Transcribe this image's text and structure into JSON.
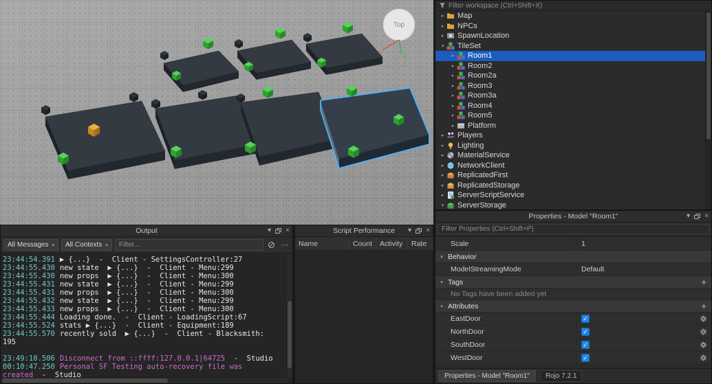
{
  "viewport": {
    "view_cube_label": "Top",
    "axis_x_label": "x",
    "axis_y_label": "y"
  },
  "explorer": {
    "filter_placeholder": "Filter workspace (Ctrl+Shift+X)",
    "items": [
      {
        "label": "Map",
        "icon": "folder",
        "depth": 0,
        "arrow": "collapsed",
        "selected": false
      },
      {
        "label": "NPCs",
        "icon": "folder",
        "depth": 0,
        "arrow": "collapsed",
        "selected": false
      },
      {
        "label": "SpawnLocation",
        "icon": "spawn",
        "depth": 0,
        "arrow": "collapsed",
        "selected": false
      },
      {
        "label": "TileSet",
        "icon": "model",
        "depth": 0,
        "arrow": "expanded",
        "selected": false
      },
      {
        "label": "Room1",
        "icon": "model",
        "depth": 1,
        "arrow": "collapsed",
        "selected": true
      },
      {
        "label": "Room2",
        "icon": "model",
        "depth": 1,
        "arrow": "collapsed",
        "selected": false
      },
      {
        "label": "Room2a",
        "icon": "model",
        "depth": 1,
        "arrow": "collapsed",
        "selected": false
      },
      {
        "label": "Room3",
        "icon": "model",
        "depth": 1,
        "arrow": "collapsed",
        "selected": false
      },
      {
        "label": "Room3a",
        "icon": "model",
        "depth": 1,
        "arrow": "collapsed",
        "selected": false
      },
      {
        "label": "Room4",
        "icon": "model",
        "depth": 1,
        "arrow": "collapsed",
        "selected": false
      },
      {
        "label": "Room5",
        "icon": "model",
        "depth": 1,
        "arrow": "collapsed",
        "selected": false
      },
      {
        "label": "Platform",
        "icon": "part",
        "depth": 1,
        "arrow": "collapsed",
        "selected": false
      },
      {
        "label": "Players",
        "icon": "players",
        "depth": 0,
        "arrow": "collapsed",
        "selected": false
      },
      {
        "label": "Lighting",
        "icon": "lighting",
        "depth": 0,
        "arrow": "collapsed",
        "selected": false
      },
      {
        "label": "MaterialService",
        "icon": "material",
        "depth": 0,
        "arrow": "collapsed",
        "selected": false
      },
      {
        "label": "NetworkClient",
        "icon": "network",
        "depth": 0,
        "arrow": "collapsed",
        "selected": false
      },
      {
        "label": "ReplicatedFirst",
        "icon": "repfirst",
        "depth": 0,
        "arrow": "collapsed",
        "selected": false
      },
      {
        "label": "ReplicatedStorage",
        "icon": "repstorage",
        "depth": 0,
        "arrow": "collapsed",
        "selected": false
      },
      {
        "label": "ServerScriptService",
        "icon": "serverscript",
        "depth": 0,
        "arrow": "collapsed",
        "selected": false
      },
      {
        "label": "ServerStorage",
        "icon": "serverstorage",
        "depth": 0,
        "arrow": "expanded",
        "selected": false
      }
    ]
  },
  "output": {
    "title": "Output",
    "toolbar": {
      "messages_filter": "All Messages",
      "contexts_filter": "All Contexts",
      "filter_placeholder": "Filter..."
    },
    "lines": [
      {
        "time": "23:44:54.391",
        "parts": [
          {
            "text": "▶ {...}  -  Client - SettingsController:27",
            "color": "default"
          }
        ]
      },
      {
        "time": "23:44:55.430",
        "parts": [
          {
            "text": "new state  ▶ {...}  -  Client - Menu:299",
            "color": "default"
          }
        ]
      },
      {
        "time": "23:44:55.430",
        "parts": [
          {
            "text": "new props  ▶ {...}  -  Client - Menu:300",
            "color": "default"
          }
        ]
      },
      {
        "time": "23:44:55.431",
        "parts": [
          {
            "text": "new state  ▶ {...}  -  Client - Menu:299",
            "color": "default"
          }
        ]
      },
      {
        "time": "23:44:55.431",
        "parts": [
          {
            "text": "new props  ▶ {...}  -  Client - Menu:300",
            "color": "default"
          }
        ]
      },
      {
        "time": "23:44:55.432",
        "parts": [
          {
            "text": "new state  ▶ {...}  -  Client - Menu:299",
            "color": "default"
          }
        ]
      },
      {
        "time": "23:44:55.433",
        "parts": [
          {
            "text": "new props  ▶ {...}  -  Client - Menu:300",
            "color": "default"
          }
        ]
      },
      {
        "time": "23:44:55.444",
        "parts": [
          {
            "text": "Loading done.  -  Client - LoadingScript:67",
            "color": "default"
          }
        ]
      },
      {
        "time": "23:44:55.524",
        "parts": [
          {
            "text": "stats ▶ {...}  -  Client - Equipment:189",
            "color": "default"
          }
        ]
      },
      {
        "time": "23:44:55.570",
        "parts": [
          {
            "text": "recently sold  ▶ {...}  -  Client - Blacksmith:",
            "color": "default"
          }
        ]
      },
      {
        "time": "",
        "parts": [
          {
            "text": "195",
            "color": "default"
          }
        ]
      },
      {
        "time": "",
        "parts": []
      },
      {
        "time": "23:49:10.506",
        "parts": [
          {
            "text": "Disconnect from ::ffff:127.0.0.1|64725",
            "color": "magenta"
          },
          {
            "text": "  -  Studio",
            "color": "default"
          }
        ]
      },
      {
        "time": "00:10:47.250",
        "parts": [
          {
            "text": "Personal SF Testing auto-recovery file was",
            "color": "magenta"
          }
        ]
      },
      {
        "time": "",
        "parts": [
          {
            "text": "created",
            "color": "magenta"
          },
          {
            "text": "  -  Studio",
            "color": "default"
          }
        ]
      }
    ]
  },
  "script_performance": {
    "title": "Script Performance",
    "columns": [
      "Name",
      "Count",
      "Activity",
      "Rate"
    ]
  },
  "properties": {
    "title": "Properties - Model \"Room1\"",
    "filter_placeholder": "Filter Properties (Ctrl+Shift+P)",
    "rows": [
      {
        "type": "prop",
        "label": "Scale",
        "value": "1"
      },
      {
        "type": "section",
        "label": "Behavior",
        "add": false
      },
      {
        "type": "prop",
        "label": "ModelStreamingMode",
        "value": "Default"
      },
      {
        "type": "section",
        "label": "Tags",
        "add": true
      },
      {
        "type": "note",
        "text": "No Tags have been added yet"
      },
      {
        "type": "section",
        "label": "Attributes",
        "add": true
      },
      {
        "type": "attr",
        "label": "EastDoor",
        "checked": true
      },
      {
        "type": "attr",
        "label": "NorthDoor",
        "checked": true
      },
      {
        "type": "attr",
        "label": "SouthDoor",
        "checked": true
      },
      {
        "type": "attr",
        "label": "WestDoor",
        "checked": true
      }
    ],
    "bottom_tab": "Properties - Model \"Room1\"",
    "version_badge": "Rojo 7.2.1"
  }
}
